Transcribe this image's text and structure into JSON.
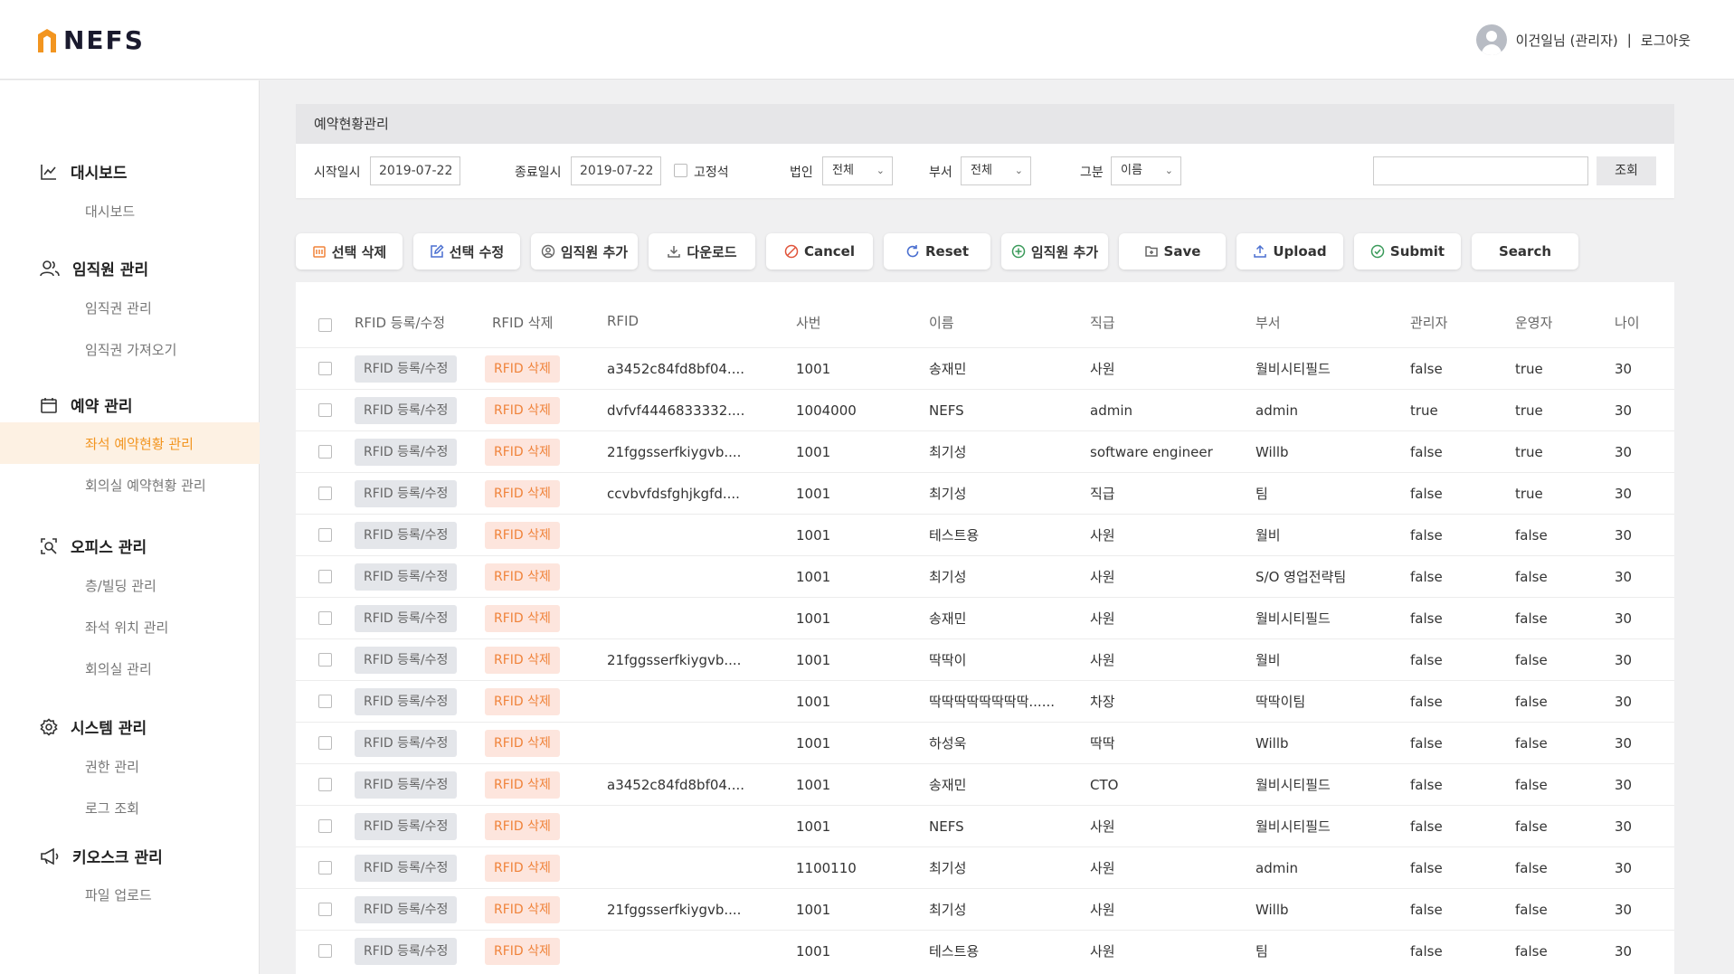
{
  "brand": {
    "name": "NEFS",
    "accent": "#f29520"
  },
  "user": {
    "name": "이건일님 (관리자)",
    "separator": "|",
    "logout": "로그아웃"
  },
  "sidebar": {
    "groups": [
      {
        "title": "대시보드",
        "icon": "chart-line-icon",
        "items": [
          "대시보드"
        ]
      },
      {
        "title": "임직원 관리",
        "icon": "users-icon",
        "items": [
          "임직권 관리",
          "임직권 가져오기"
        ]
      },
      {
        "title": "예약 관리",
        "icon": "calendar-icon",
        "items": [
          "좌석 예약현황 관리",
          "회의실 예약현황 관리"
        ]
      },
      {
        "title": "오피스 관리",
        "icon": "office-search-icon",
        "items": [
          "층/빌딩 관리",
          "좌석 위치 관리",
          "회의실 관리"
        ]
      },
      {
        "title": "시스템 관리",
        "icon": "gear-icon",
        "items": [
          "권한 관리",
          "로그 조회"
        ]
      },
      {
        "title": "키오스크 관리",
        "icon": "megaphone-icon",
        "items": [
          "파일 업로드"
        ]
      }
    ],
    "active_item": "좌석 예약현황 관리"
  },
  "panel": {
    "title": "예약현황관리"
  },
  "filter": {
    "start_label": "시작일시",
    "start_value": "2019-07-22",
    "end_label": "종료일시",
    "end_value": "2019-07-22",
    "fixed_label": "고정석",
    "corp_label": "법인",
    "corp_value": "전체",
    "dept_label": "부서",
    "dept_value": "전체",
    "type_label": "그분",
    "type_value": "이름",
    "search_value": "",
    "search_button": "조회"
  },
  "toolbar": [
    {
      "label": "선택 삭제",
      "icon": "trash-icon",
      "color": "#f0833a"
    },
    {
      "label": "선택 수정",
      "icon": "edit-icon",
      "color": "#4a6fd0"
    },
    {
      "label": "임직원 추가",
      "icon": "user-circle-icon",
      "color": "#666666"
    },
    {
      "label": "다운로드",
      "icon": "download-icon",
      "color": "#666666"
    },
    {
      "label": "Cancel",
      "icon": "cancel-icon",
      "color": "#e0533a"
    },
    {
      "label": "Reset",
      "icon": "reset-icon",
      "color": "#4a6fd0"
    },
    {
      "label": "임직원 추가",
      "icon": "plus-circle-icon",
      "color": "#3a9a5a"
    },
    {
      "label": "Save",
      "icon": "save-icon",
      "color": "#666666"
    },
    {
      "label": "Upload",
      "icon": "upload-icon",
      "color": "#4a6fd0"
    },
    {
      "label": "Submit",
      "icon": "check-circle-icon",
      "color": "#3a9a5a"
    },
    {
      "label": "Search",
      "icon": "",
      "color": "#333333"
    }
  ],
  "table": {
    "columns": [
      "RFID 등록/수정",
      "RFID 삭제",
      "RFID",
      "사번",
      "이름",
      "직급",
      "부서",
      "관리자",
      "운영자",
      "나이"
    ],
    "rfid_edit_label": "RFID 등록/수정",
    "rfid_delete_label": "RFID 삭제",
    "rows": [
      [
        "a3452c84fd8bf04....",
        "1001",
        "송재민",
        "사원",
        "월비시티필드",
        "false",
        "true",
        "30"
      ],
      [
        "dvfvf4446833332....",
        "1004000",
        "NEFS",
        "admin",
        "admin",
        "true",
        "true",
        "30"
      ],
      [
        "21fggsserfkiygvb....",
        "1001",
        "최기성",
        "software engineer",
        "Willb",
        "false",
        "true",
        "30"
      ],
      [
        "ccvbvfdsfghjkgfd....",
        "1001",
        "최기성",
        "직급",
        "팀",
        "false",
        "true",
        "30"
      ],
      [
        "",
        "1001",
        "테스트용",
        "사원",
        "월비",
        "false",
        "false",
        "30"
      ],
      [
        "",
        "1001",
        "최기성",
        "사원",
        "S/O 영업전략팀",
        "false",
        "false",
        "30"
      ],
      [
        "",
        "1001",
        "송재민",
        "사원",
        "월비시티필드",
        "false",
        "false",
        "30"
      ],
      [
        "21fggsserfkiygvb....",
        "1001",
        "딱딱이",
        "사원",
        "월비",
        "false",
        "false",
        "30"
      ],
      [
        "",
        "1001",
        "딱딱딱딱딱딱딱딱......",
        "차장",
        "딱딱이팀",
        "false",
        "false",
        "30"
      ],
      [
        "",
        "1001",
        "하성욱",
        "딱딱",
        "Willb",
        "false",
        "false",
        "30"
      ],
      [
        "a3452c84fd8bf04....",
        "1001",
        "송재민",
        "CTO",
        "월비시티필드",
        "false",
        "false",
        "30"
      ],
      [
        "",
        "1001",
        "NEFS",
        "사원",
        "월비시티필드",
        "false",
        "false",
        "30"
      ],
      [
        "",
        "1100110",
        "최기성",
        "사원",
        "admin",
        "false",
        "false",
        "30"
      ],
      [
        "21fggsserfkiygvb....",
        "1001",
        "최기성",
        "사원",
        "Willb",
        "false",
        "false",
        "30"
      ],
      [
        "",
        "1001",
        "테스트용",
        "사원",
        "팀",
        "false",
        "false",
        "30"
      ]
    ]
  }
}
